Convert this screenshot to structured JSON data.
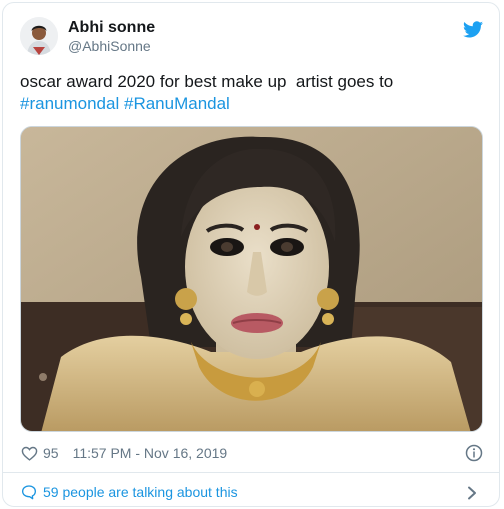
{
  "author": {
    "display_name": "Abhi sonne",
    "handle": "@AbhiSonne"
  },
  "tweet": {
    "text_plain": "oscar award 2020 for best make up  artist goes to",
    "hashtags": [
      "#ranumondal",
      "#RanuMandal"
    ]
  },
  "meta": {
    "like_count": "95",
    "timestamp": "11:57 PM - Nov 16, 2019"
  },
  "footer": {
    "conversation_label": "59 people are talking about this"
  },
  "icons": {
    "brand": "twitter-bird-icon",
    "like": "heart-icon",
    "info": "info-icon",
    "conversation": "speech-bubble-icon",
    "navigate": "chevron-right-icon"
  },
  "colors": {
    "primary_text": "#14171a",
    "secondary_text": "#657786",
    "link_blue": "#1b95e0",
    "border": "#e1e8ed"
  }
}
